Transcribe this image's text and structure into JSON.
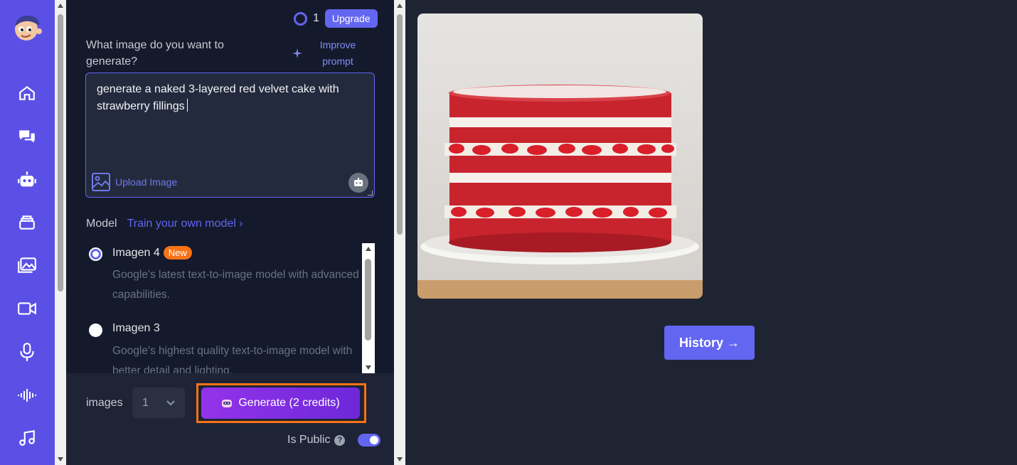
{
  "credits": {
    "count": "1",
    "upgrade_label": "Upgrade"
  },
  "prompt": {
    "question": "What image do you want to generate?",
    "improve_label": "Improve prompt",
    "value": "generate a naked 3-layered red velvet cake with strawberry fillings",
    "upload_label": "Upload Image"
  },
  "model": {
    "label": "Model",
    "train_link": "Train your own model ›",
    "options": [
      {
        "name": "Imagen 4",
        "badge": "New",
        "description": "Google's latest text-to-image model with advanced capabilities.",
        "selected": true
      },
      {
        "name": "Imagen 3",
        "description": "Google's highest quality text-to-image model with better detail and lighting.",
        "selected": false
      }
    ]
  },
  "footer": {
    "images_label": "images",
    "images_value": "1",
    "generate_label": "Generate (2 credits)",
    "public_label": "Is Public",
    "public_on": true
  },
  "history_label": "History →",
  "nav": [
    "home-icon",
    "chat-icon",
    "robot-icon",
    "stack-icon",
    "gallery-icon",
    "video-icon",
    "microphone-icon",
    "waveform-icon",
    "music-icon"
  ],
  "colors": {
    "accent": "#6366f1",
    "rail": "#5b50e6",
    "highlight": "#f97316",
    "badge": "#f97316"
  }
}
